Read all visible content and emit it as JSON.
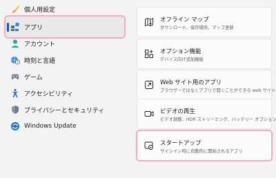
{
  "sidebar": {
    "items": [
      {
        "label": "個人用設定",
        "icon": "brush-icon"
      },
      {
        "label": "アプリ",
        "icon": "apps-icon",
        "active": true
      },
      {
        "label": "アカウント",
        "icon": "person-icon"
      },
      {
        "label": "時刻と言語",
        "icon": "globe-clock-icon"
      },
      {
        "label": "ゲーム",
        "icon": "gamepad-icon"
      },
      {
        "label": "アクセシビリティ",
        "icon": "accessibility-icon"
      },
      {
        "label": "プライバシーとセキュリティ",
        "icon": "shield-icon"
      },
      {
        "label": "Windows Update",
        "icon": "windows-update-icon"
      }
    ]
  },
  "cards": [
    {
      "title": "オフライン マップ",
      "subtitle": "ダウンロード、保存場所、マップ更新",
      "icon": "offline-map-icon"
    },
    {
      "title": "オプション機能",
      "subtitle": "デバイス向け追加機能",
      "icon": "optional-features-icon"
    },
    {
      "title": "Web サイト用のアプリ",
      "subtitle": "ブラウザーではなくアプリで開くことができる web サイト",
      "icon": "open-in-app-icon"
    },
    {
      "title": "ビデオの再生",
      "subtitle": "ビデオ調整、HDR ストリーミング、バッテリー オプション",
      "icon": "video-icon"
    },
    {
      "title": "スタートアップ",
      "subtitle": "サインイン時に自動的に開始されるアプリ",
      "icon": "startup-icon",
      "highlighted": true
    }
  ],
  "colors": {
    "accent": "#005fb8",
    "highlight": "#f4a9c6"
  }
}
